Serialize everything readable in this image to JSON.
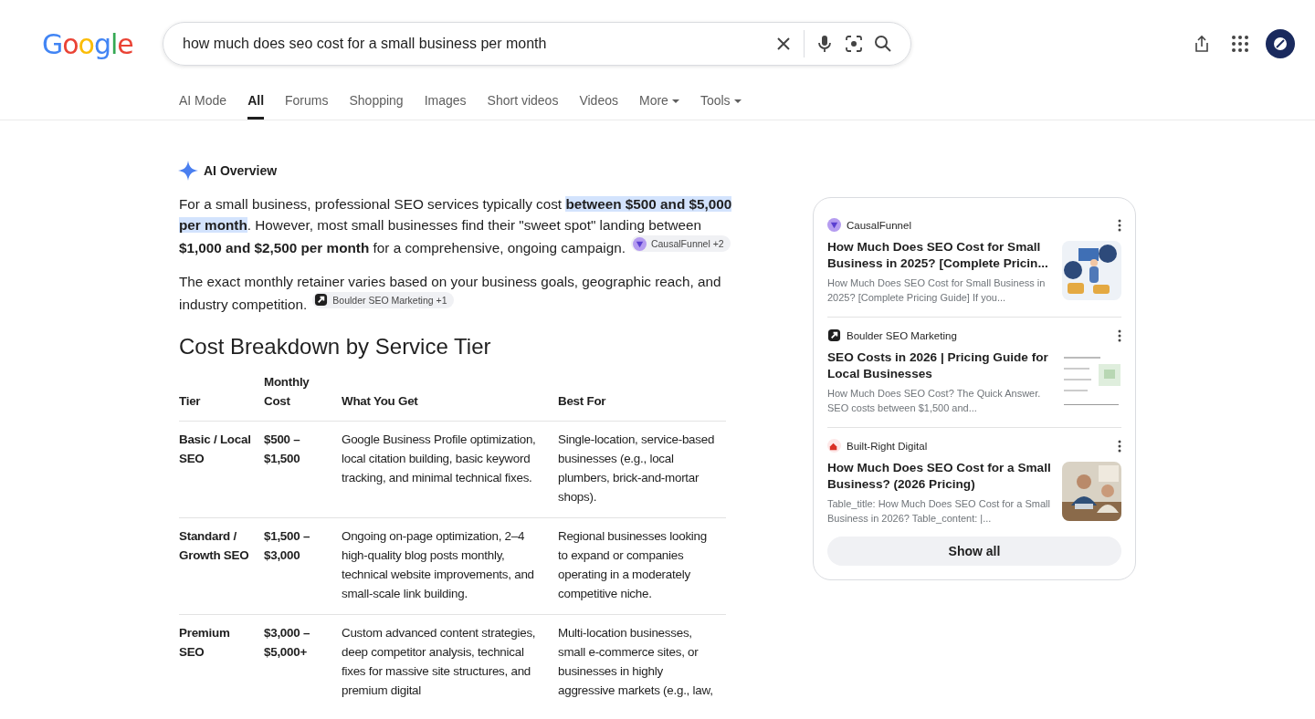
{
  "header": {
    "logo": "Google",
    "search": {
      "value": "how much does seo cost for a small business per month"
    }
  },
  "tabs": [
    {
      "label": "AI Mode",
      "selected": false,
      "kind": "plain"
    },
    {
      "label": "All",
      "selected": true,
      "kind": "plain"
    },
    {
      "label": "Forums",
      "selected": false,
      "kind": "plain"
    },
    {
      "label": "Shopping",
      "selected": false,
      "kind": "plain"
    },
    {
      "label": "Images",
      "selected": false,
      "kind": "plain"
    },
    {
      "label": "Short videos",
      "selected": false,
      "kind": "plain"
    },
    {
      "label": "Videos",
      "selected": false,
      "kind": "plain"
    },
    {
      "label": "More",
      "selected": false,
      "kind": "menu"
    },
    {
      "label": "Tools",
      "selected": false,
      "kind": "menu"
    }
  ],
  "overview": {
    "title": "AI Overview",
    "paragraphs": [
      {
        "segments": [
          {
            "text": "For a small business, professional SEO services typically cost ",
            "bold": false,
            "highlight": false
          },
          {
            "text": "between $500 and $5,000 per month",
            "bold": true,
            "highlight": true
          },
          {
            "text": ". However, most small businesses find their \"sweet spot\" landing between ",
            "bold": false,
            "highlight": false
          },
          {
            "text": "$1,000 and $2,500 per month",
            "bold": true,
            "highlight": false
          },
          {
            "text": " for a comprehensive, ongoing campaign.",
            "bold": false,
            "highlight": false
          }
        ],
        "citation": {
          "label": "CausalFunnel +2",
          "kind": "funnel"
        }
      },
      {
        "segments": [
          {
            "text": "The exact monthly retainer varies based on your business goals, geographic reach, and industry competition.",
            "bold": false,
            "highlight": false
          }
        ],
        "citation": {
          "label": "Boulder SEO Marketing +1",
          "kind": "arrow"
        }
      }
    ],
    "heading": "Cost Breakdown by Service Tier",
    "table": {
      "columns": [
        "Tier",
        "Monthly Cost",
        "What You Get",
        "Best For"
      ],
      "rows": [
        [
          "Basic / Local SEO",
          "$500 – $1,500",
          "Google Business Profile optimization, local citation building, basic keyword tracking, and minimal technical fixes.",
          "Single-location, service-based businesses (e.g., local plumbers, brick-and-mortar shops)."
        ],
        [
          "Standard / Growth SEO",
          "$1,500 – $3,000",
          "Ongoing on-page optimization, 2–4 high-quality blog posts monthly, technical website improvements, and small-scale link building.",
          "Regional businesses looking to expand or companies operating in a moderately competitive niche."
        ],
        [
          "Premium SEO",
          "$3,000 – $5,000+",
          "Custom advanced content strategies, deep competitor analysis, technical fixes for massive site structures, and premium digital",
          "Multi-location businesses, small e-commerce sites, or businesses in highly aggressive markets (e.g., law,"
        ]
      ]
    }
  },
  "sources": {
    "items": [
      {
        "site": "CausalFunnel",
        "kind": "funnel",
        "title": "How Much Does SEO Cost for Small Business in 2025? [Complete Pricin...",
        "snippet": "How Much Does SEO Cost for Small Business in 2025? [Complete Pricing Guide] If you..."
      },
      {
        "site": "Boulder SEO Marketing",
        "kind": "arrow",
        "title": "SEO Costs in 2026 | Pricing Guide for Local Businesses",
        "snippet": "How Much Does SEO Cost? The Quick Answer. SEO costs between $1,500 and..."
      },
      {
        "site": "Built-Right Digital",
        "kind": "house",
        "title": "How Much Does SEO Cost for a Small Business? (2026 Pricing)",
        "snippet": "Table_title: How Much Does SEO Cost for a Small Business in 2026? Table_content: |..."
      }
    ],
    "show_all": "Show all"
  }
}
